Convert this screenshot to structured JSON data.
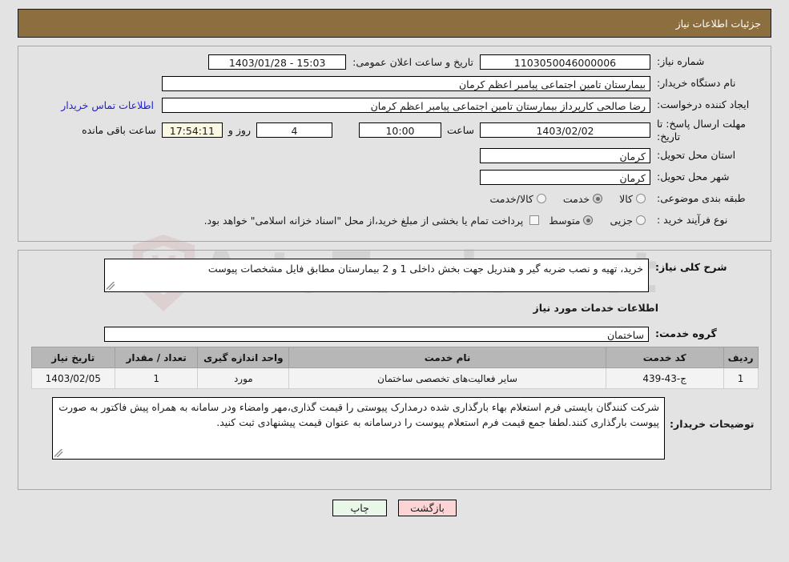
{
  "header": {
    "title": "جزئیات اطلاعات نیاز"
  },
  "watermark": {
    "text": "ArtaTender.net"
  },
  "form": {
    "need_number_label": "شماره نیاز:",
    "need_number_value": "1103050046000006",
    "public_announce_label": "تاریخ و ساعت اعلان عمومی:",
    "public_announce_value": "15:03 - 1403/01/28",
    "buyer_org_label": "نام دستگاه خریدار:",
    "buyer_org_value": "بیمارستان تامین اجتماعی پیامبر اعظم کرمان",
    "requester_label": "ایجاد کننده درخواست:",
    "requester_value": "رضا صالحی  کارپرداز بیمارستان تامین اجتماعی پیامبر اعظم کرمان",
    "contact_link": "اطلاعات تماس خریدار",
    "deadline_label": "مهلت ارسال پاسخ: تا تاریخ:",
    "deadline_date": "1403/02/02",
    "hour_label": "ساعت",
    "hour_value": "10:00",
    "days_value": "4",
    "days_label": "روز و",
    "countdown_value": "17:54:11",
    "countdown_label": "ساعت باقی مانده",
    "province_label": "استان محل تحویل:",
    "province_value": "کرمان",
    "city_label": "شهر محل تحویل:",
    "city_value": "کرمان",
    "category_label": "طبقه بندی موضوعی:",
    "category_options": [
      {
        "label": "کالا",
        "selected": false
      },
      {
        "label": "خدمت",
        "selected": true
      },
      {
        "label": "کالا/خدمت",
        "selected": false
      }
    ],
    "process_label": "نوع فرآیند خرید :",
    "process_options": [
      {
        "label": "جزیی",
        "selected": false
      },
      {
        "label": "متوسط",
        "selected": true
      }
    ],
    "treasury_note": "پرداخت تمام یا بخشی از مبلغ خرید،از محل \"اسناد خزانه اسلامی\" خواهد بود.",
    "treasury_checked": false
  },
  "details": {
    "overall_desc_label": "شرح کلی نیاز:",
    "overall_desc_value": "خرید، تهیه و نصب ضربه گیر و هندریل جهت بخش داخلی 1 و 2 بیمارستان مطابق فایل مشخصات پیوست",
    "services_section_title": "اطلاعات خدمات مورد نیاز",
    "service_group_label": "گروه خدمت:",
    "service_group_value": "ساختمان",
    "table": {
      "headers": [
        "ردیف",
        "کد خدمت",
        "نام خدمت",
        "واحد اندازه گیری",
        "تعداد / مقدار",
        "تاریخ نیاز"
      ],
      "rows": [
        {
          "radif": "1",
          "code": "ج-43-439",
          "name": "سایر فعالیت‌های تخصصی ساختمان",
          "unit": "مورد",
          "qty": "1",
          "date": "1403/02/05"
        }
      ]
    },
    "buyer_notes_label": "توضیحات خریدار:",
    "buyer_notes_value": "شرکت کنندگان بایستی فرم استعلام بهاء بارگذاری شده درمدارک پیوستی را قیمت گذاری،مهر وامضاء ودر سامانه به همراه پیش فاکتور به صورت پیوست بارگذاری کنند.لطفا جمع قیمت فرم استعلام پیوست را درسامانه به عنوان قیمت پیشنهادی ثبت کنید."
  },
  "buttons": {
    "print": "چاپ",
    "back": "بازگشت"
  },
  "colors": {
    "header_brown": "#8d6e3f",
    "page_bg": "#e3e3e3",
    "link_blue": "#2222cc",
    "countdown_bg": "#fbf8e3",
    "table_header": "#b7b7b7",
    "print_btn": "#e9f7e9",
    "back_btn": "#fbd5d5"
  }
}
